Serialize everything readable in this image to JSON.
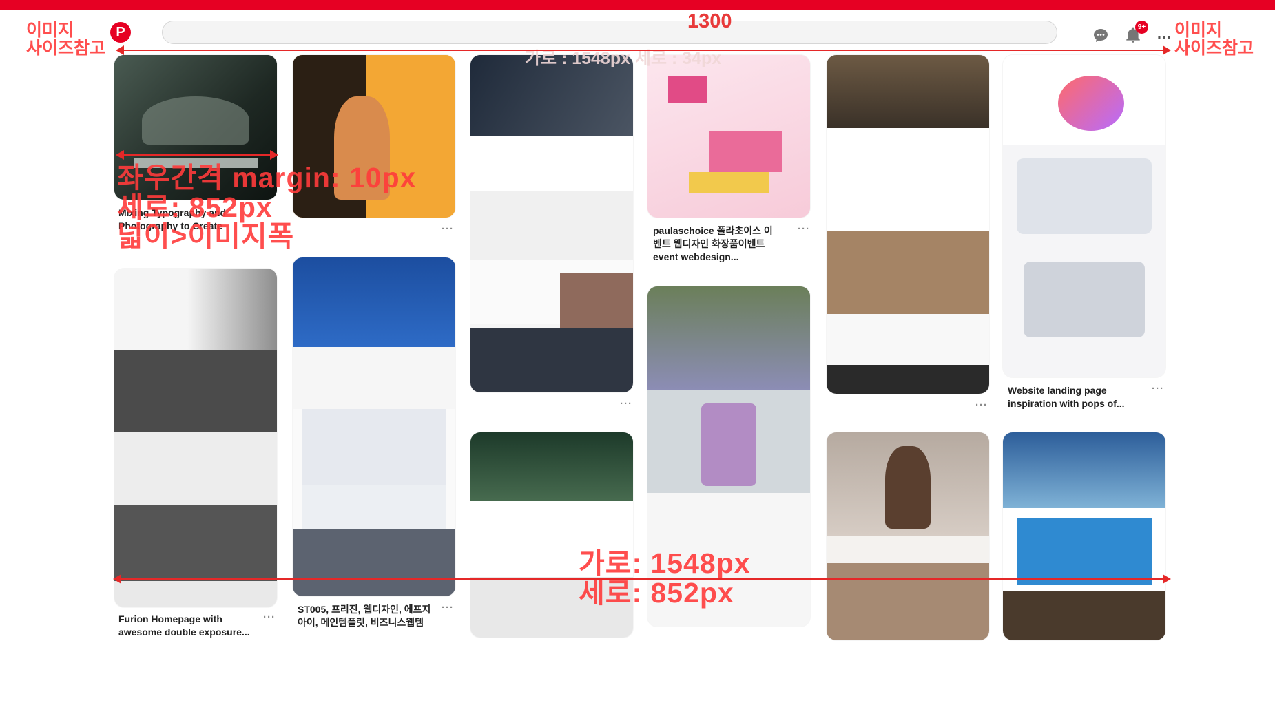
{
  "header": {
    "logo_letter": "P",
    "notification_badge": "9+",
    "more_label": "…",
    "colors": {
      "brand": "#e60023"
    }
  },
  "annotations": {
    "top_width": "1300",
    "left_label": "이미지\n사이즈참고",
    "right_label": "이미지\n사이즈참고",
    "header_size": "가로 : 1548px 세로 : 34px",
    "gap_note": "좌우간격 margin: 10px",
    "height_note": "세로: 852px",
    "rule_note": "넓이>이미지폭",
    "body_width": "가로: 1548px",
    "body_height": "세로: 852px"
  },
  "pins": [
    {
      "caption": "Mixing Typography and Photography to Create",
      "more": "···"
    },
    {
      "caption": "",
      "more": "···"
    },
    {
      "caption": "",
      "more": "···"
    },
    {
      "caption": "paulaschoice 폴라초이스 이벤트 웹디자인 화장품이벤트 event webdesign...",
      "more": "···"
    },
    {
      "caption": "",
      "more": "···"
    },
    {
      "caption": "Website landing page inspiration with pops of...",
      "more": "···"
    },
    {
      "caption": "Furion Homepage with awesome double exposure...",
      "more": "···"
    },
    {
      "caption": "ST005, 프리진, 웹디자인, 에프지아이, 메인템플릿, 비즈니스웹템",
      "more": "···"
    },
    {
      "caption": "",
      "more": ""
    },
    {
      "caption": "",
      "more": ""
    },
    {
      "caption": "",
      "more": ""
    },
    {
      "caption": "",
      "more": ""
    }
  ]
}
